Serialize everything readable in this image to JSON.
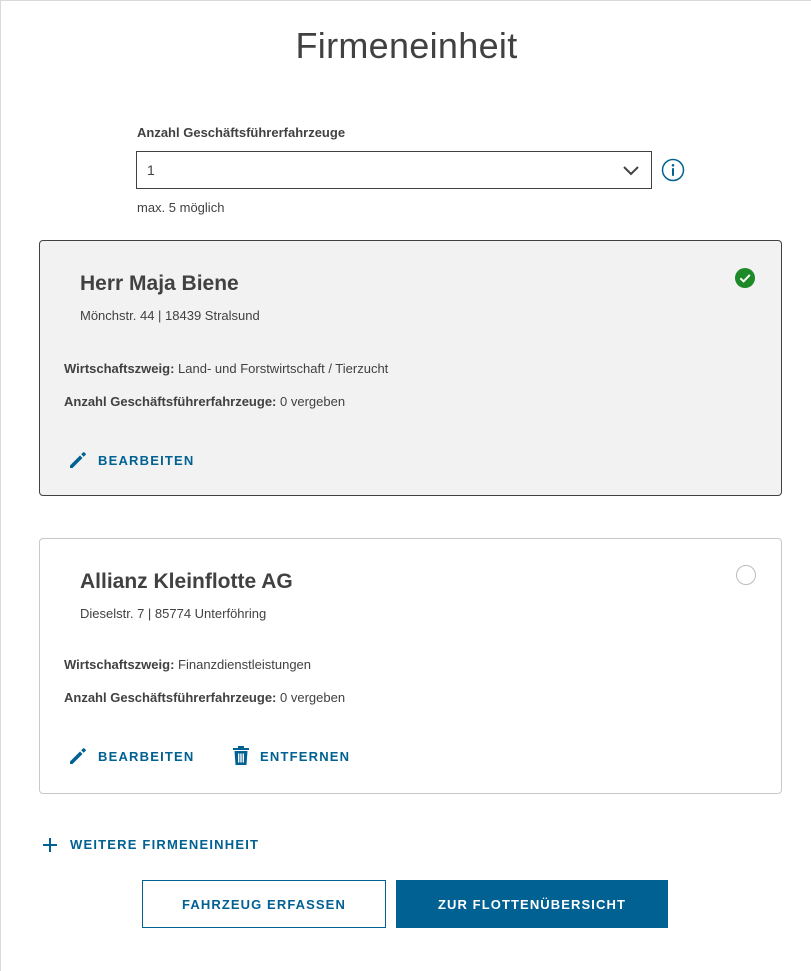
{
  "page": {
    "title": "Firmeneinheit"
  },
  "vehicles_field": {
    "label": "Anzahl Geschäftsführerfahrzeuge",
    "value": "1",
    "hint": "max. 5 möglich"
  },
  "companies": [
    {
      "name": "Herr Maja Biene",
      "address": "Mönchstr. 44 | 18439 Stralsund",
      "sector_label": "Wirtschaftszweig:",
      "sector_value": "Land- und Forstwirtschaft / Tierzucht",
      "vehicles_label": "Anzahl Geschäftsführerfahrzeuge:",
      "vehicles_value": "0 vergeben",
      "edit_label": "BEARBEITEN",
      "selected": true
    },
    {
      "name": "Allianz Kleinflotte AG",
      "address": "Dieselstr. 7 | 85774 Unterföhring",
      "sector_label": "Wirtschaftszweig:",
      "sector_value": "Finanzdienstleistungen",
      "vehicles_label": "Anzahl Geschäftsführerfahrzeuge:",
      "vehicles_value": "0 vergeben",
      "edit_label": "BEARBEITEN",
      "remove_label": "ENTFERNEN",
      "selected": false
    }
  ],
  "add_company_label": "WEITERE FIRMENEINHEIT",
  "buttons": {
    "capture_vehicle": "FAHRZEUG ERFASSEN",
    "fleet_overview": "ZUR FLOTTENÜBERSICHT"
  },
  "colors": {
    "accent": "#006192",
    "success": "#1e8927",
    "text": "#414141",
    "selected_card_bg": "#f2f2f2"
  },
  "icons": [
    "chevron-down-icon",
    "info-icon",
    "check-circle-icon",
    "pencil-icon",
    "trash-icon",
    "plus-icon"
  ]
}
